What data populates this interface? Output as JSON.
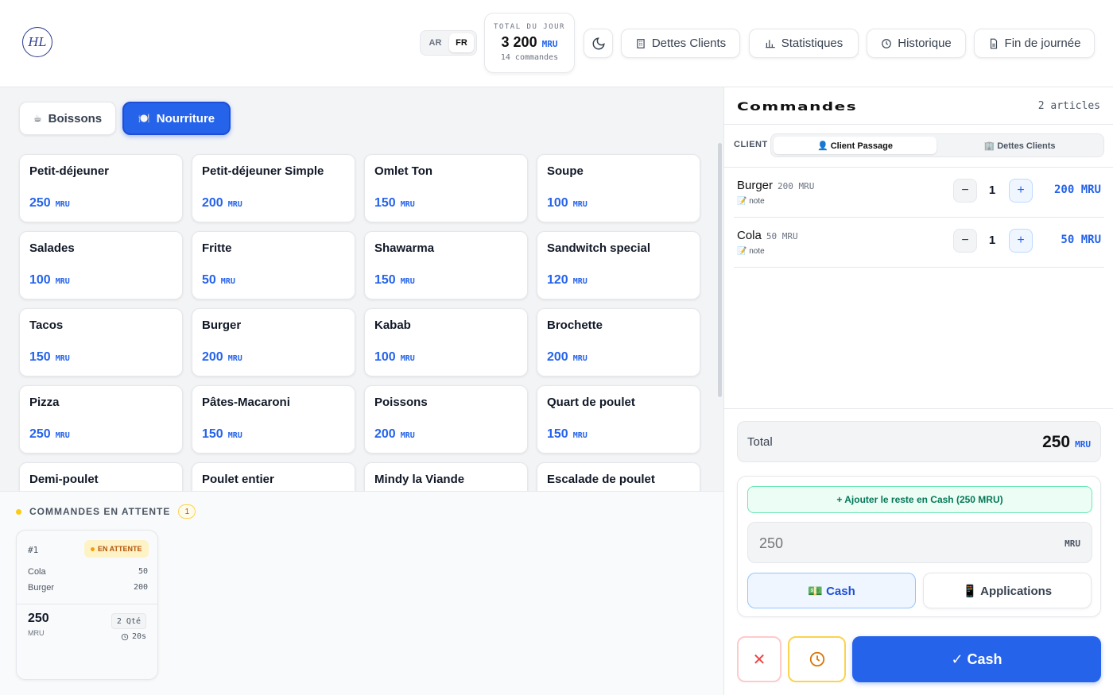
{
  "header": {
    "logo_initials": "HL",
    "logo_subtitle": "",
    "lang": {
      "ar": "AR",
      "fr": "FR",
      "active": "FR"
    },
    "day_total": {
      "label": "TOTAL DU JOUR",
      "value": "3 200",
      "currency": "MRU",
      "orders": "14 commandes"
    },
    "buttons": {
      "debts": "Dettes Clients",
      "stats": "Statistiques",
      "history": "Historique",
      "end_day": "Fin de journée"
    }
  },
  "categories": [
    {
      "label": "Boissons",
      "icon": "☕",
      "active": false
    },
    {
      "label": "Nourriture",
      "icon": "🍽️",
      "active": true
    }
  ],
  "products": [
    {
      "name": "Petit-déjeuner",
      "price": "250",
      "currency": "MRU"
    },
    {
      "name": "Petit-déjeuner Simple",
      "price": "200",
      "currency": "MRU"
    },
    {
      "name": "Omlet Ton",
      "price": "150",
      "currency": "MRU"
    },
    {
      "name": "Soupe",
      "price": "100",
      "currency": "MRU"
    },
    {
      "name": "Salades",
      "price": "100",
      "currency": "MRU"
    },
    {
      "name": "Fritte",
      "price": "50",
      "currency": "MRU"
    },
    {
      "name": "Shawarma",
      "price": "150",
      "currency": "MRU"
    },
    {
      "name": "Sandwitch special",
      "price": "120",
      "currency": "MRU"
    },
    {
      "name": "Tacos",
      "price": "150",
      "currency": "MRU"
    },
    {
      "name": "Burger",
      "price": "200",
      "currency": "MRU"
    },
    {
      "name": "Kabab",
      "price": "100",
      "currency": "MRU"
    },
    {
      "name": "Brochette",
      "price": "200",
      "currency": "MRU"
    },
    {
      "name": "Pizza",
      "price": "250",
      "currency": "MRU"
    },
    {
      "name": "Pâtes-Macaroni",
      "price": "150",
      "currency": "MRU"
    },
    {
      "name": "Poissons",
      "price": "200",
      "currency": "MRU"
    },
    {
      "name": "Quart de poulet",
      "price": "150",
      "currency": "MRU"
    },
    {
      "name": "Demi-poulet",
      "price": "",
      "currency": ""
    },
    {
      "name": "Poulet entier",
      "price": "",
      "currency": ""
    },
    {
      "name": "Mindy la Viande",
      "price": "",
      "currency": ""
    },
    {
      "name": "Escalade de poulet",
      "price": "",
      "currency": ""
    }
  ],
  "pending": {
    "title": "COMMANDES EN ATTENTE",
    "count": "1",
    "orders": [
      {
        "number": "#1",
        "status": "EN ATTENTE",
        "lines": [
          {
            "name": "Cola",
            "value": "50"
          },
          {
            "name": "Burger",
            "value": "200"
          }
        ],
        "total": "250",
        "currency": "MRU",
        "qty": "2 Qté",
        "time": "20s"
      }
    ]
  },
  "order": {
    "title": "Commandes",
    "count": "2 articles",
    "client_label": "CLIENT",
    "client_options": [
      {
        "label": "👤 Client Passage",
        "active": true
      },
      {
        "label": "🏢 Dettes Clients",
        "active": false
      }
    ],
    "items": [
      {
        "name": "Burger",
        "unit": "200 MRU",
        "note": "📝 note",
        "qty": "1",
        "total": "200 MRU"
      },
      {
        "name": "Cola",
        "unit": "50 MRU",
        "note": "📝 note",
        "qty": "1",
        "total": "50 MRU"
      }
    ],
    "total_label": "Total",
    "total_value": "250",
    "total_currency": "MRU",
    "add_rest": "+ Ajouter le reste en Cash (250 MRU)",
    "amount_placeholder": "250",
    "amount_currency": "MRU",
    "methods": [
      {
        "label": "💵 Cash",
        "active": true
      },
      {
        "label": "📱 Applications",
        "active": false
      }
    ],
    "pay_label": "✓ Cash"
  }
}
